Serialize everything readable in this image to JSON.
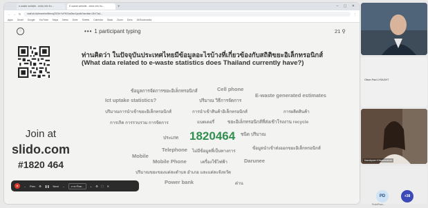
{
  "browser": {
    "tabs": [
      {
        "label": "e-waste website - extra info fro..."
      },
      {
        "label": "E-waste website - extra info fro..."
      }
    ],
    "url": "wall.sli.do/event/mWmvq2GOrrYzFKGxa3wr1/polls?section=2b17a4-...",
    "bookmarks": [
      "Apps",
      "Gmail",
      "Google",
      "YouTube",
      "Maps",
      "News",
      "Drive",
      "Sheets",
      "Calendar",
      "Slack",
      "Zoom",
      "Docs",
      "All Bookmarks"
    ]
  },
  "slido": {
    "typing_text": "1 participant typing",
    "counter": "21",
    "join_label": "Join at",
    "domain": "slido.com",
    "event_code": "#1820 464",
    "question_thai": "ท่านคิดว่า ในปัจจุบันประเทศไทยมีข้อมูลอะไรบ้างที่เกี่ยวข้องกับสถิติขยะอิเล็กทรอนิกส์",
    "question_en": "(What data related to e-waste statistics does Thailand currently have?)",
    "words": [
      {
        "text": "ข้อมูลการจัดการขยะอิเล็กทรอนิกส์",
        "color": "#8a8a8a"
      },
      {
        "text": "Cell phone",
        "color": "#8a8a8a"
      },
      {
        "text": "Ict uptake statistics?",
        "color": "#8a8a8a"
      },
      {
        "text": "E-waste generated estimates",
        "color": "#8a8a8a"
      },
      {
        "text": "ปริมาณ วิธีการจัดการ",
        "color": "#8a8a8a"
      },
      {
        "text": "ปริมาณการนำเข้าขยะอิเล็กทรอนิกส์",
        "color": "#8a8a8a"
      },
      {
        "text": "การนำเข้าสินค้าอิเล็กทรอนิกส์",
        "color": "#8a8a8a"
      },
      {
        "text": "การผลิตสินค้า",
        "color": "#8a8a8a"
      },
      {
        "text": "การเกิด การรวบรวม การจัดการ",
        "color": "#8a8a8a"
      },
      {
        "text": "แบตเตอรี่",
        "color": "#8a8a8a"
      },
      {
        "text": "ขยะอิเล็กทรอนิกส์ที่ส่งเข้าโรงงาน recycle",
        "color": "#8a8a8a"
      },
      {
        "text": "ประเภท",
        "color": "#8a8a8a"
      },
      {
        "text": "1820464",
        "color": "#2f8f4e"
      },
      {
        "text": "ชนิด ปริมาณ",
        "color": "#8a8a8a"
      },
      {
        "text": "Telephone",
        "color": "#8a8a8a"
      },
      {
        "text": "ไม่มีข้อมูลที่เป็นทางการ",
        "color": "#8a8a8a"
      },
      {
        "text": "ข้อมูลนำเข้าส่งออกขยะอิเล็กทรอนิกส์",
        "color": "#8a8a8a"
      },
      {
        "text": "Mobile",
        "color": "#8a8a8a"
      },
      {
        "text": "Mobile Phone",
        "color": "#8a8a8a"
      },
      {
        "text": "เครื่องใช้ไฟฟ้า",
        "color": "#8a8a8a"
      },
      {
        "text": "Darunee",
        "color": "#8a8a8a"
      },
      {
        "text": "ปริมาณขยะของแต่ละตำบล อำเภอ และแต่ละจังหวัด",
        "color": "#8a8a8a"
      },
      {
        "text": "Power bank",
        "color": "#8a8a8a"
      },
      {
        "text": "ต่าน",
        "color": "#8a8a8a"
      }
    ]
  },
  "presenter_controls": {
    "items": [
      "Prev",
      "Next"
    ],
    "select_label": "ภาษาไทย..."
  },
  "video": {
    "participant1": "Oliver-Paul LYSAGHT",
    "participant2": "Kanokporn Khwanmanee",
    "initials": "PD",
    "initials_label": "ProfsPhan...",
    "more_count": "+38"
  }
}
